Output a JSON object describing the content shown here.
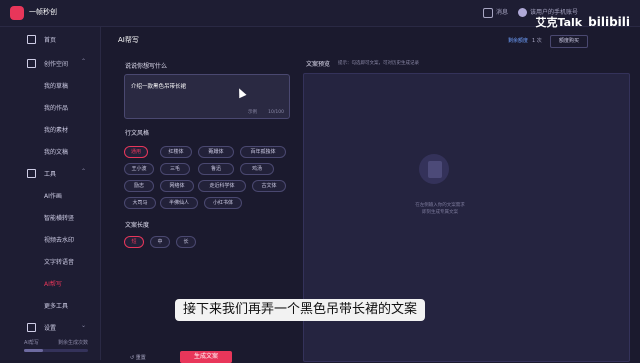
{
  "app": {
    "name": "一帧秒创"
  },
  "topbar": {
    "message": "消息",
    "vip": "",
    "username": "该用户的手机账号"
  },
  "watermark": {
    "left": "艾克Talk",
    "right": "bilibili"
  },
  "sidebar": {
    "items": [
      {
        "label": "首页",
        "icon": "home-icon"
      },
      {
        "label": "创作空间",
        "icon": "folder-icon"
      },
      {
        "label": "我的草稿"
      },
      {
        "label": "我的作品"
      },
      {
        "label": "我的素材"
      },
      {
        "label": "我的文稿"
      },
      {
        "label": "工具",
        "icon": "toolbox-icon"
      },
      {
        "label": "AI作画"
      },
      {
        "label": "智能横转竖"
      },
      {
        "label": "视频去水印"
      },
      {
        "label": "文字转语音"
      },
      {
        "label": "AI帮写"
      },
      {
        "label": "更多工具"
      },
      {
        "label": "设置",
        "icon": "gear-icon"
      }
    ],
    "bottom_left": "AI帮写",
    "bottom_right": "剩余生成次数",
    "active_index": 11,
    "usage_fraction": 0.3
  },
  "main": {
    "title": "AI帮写",
    "quota_label": "剩余额度",
    "quota_value": "1 次",
    "buy_label": "额度购买",
    "prompt_label": "说说你想写什么",
    "prompt_value": "介绍一款黑色吊带长裙",
    "prompt_tool": "示例",
    "prompt_counter": "10/100",
    "style_label": "行文风格",
    "styles": [
      "通用",
      "红楼体",
      "甄嬛体",
      "百年孤独体",
      "王小波",
      "三毛",
      "鲁迅",
      "鸡汤",
      "励志",
      "网络体",
      "走近科学体",
      "古文体",
      "大司马",
      "半佛仙人",
      "小红书体"
    ],
    "style_selected": 0,
    "length_label": "文案长度",
    "lengths": [
      "短",
      "中",
      "长"
    ],
    "length_selected": 0,
    "reset_label": "重置",
    "generate_label": "生成文案"
  },
  "preview": {
    "title": "文案预览",
    "hint": "提示：勾选即可文案，可对历史生成记录",
    "empty_line1": "在左侧输入你的文案需求",
    "empty_line2": "即刻生成专属文案"
  },
  "subtitle": {
    "text": "接下来我们再弄一个黑色吊带长裙的文案"
  }
}
